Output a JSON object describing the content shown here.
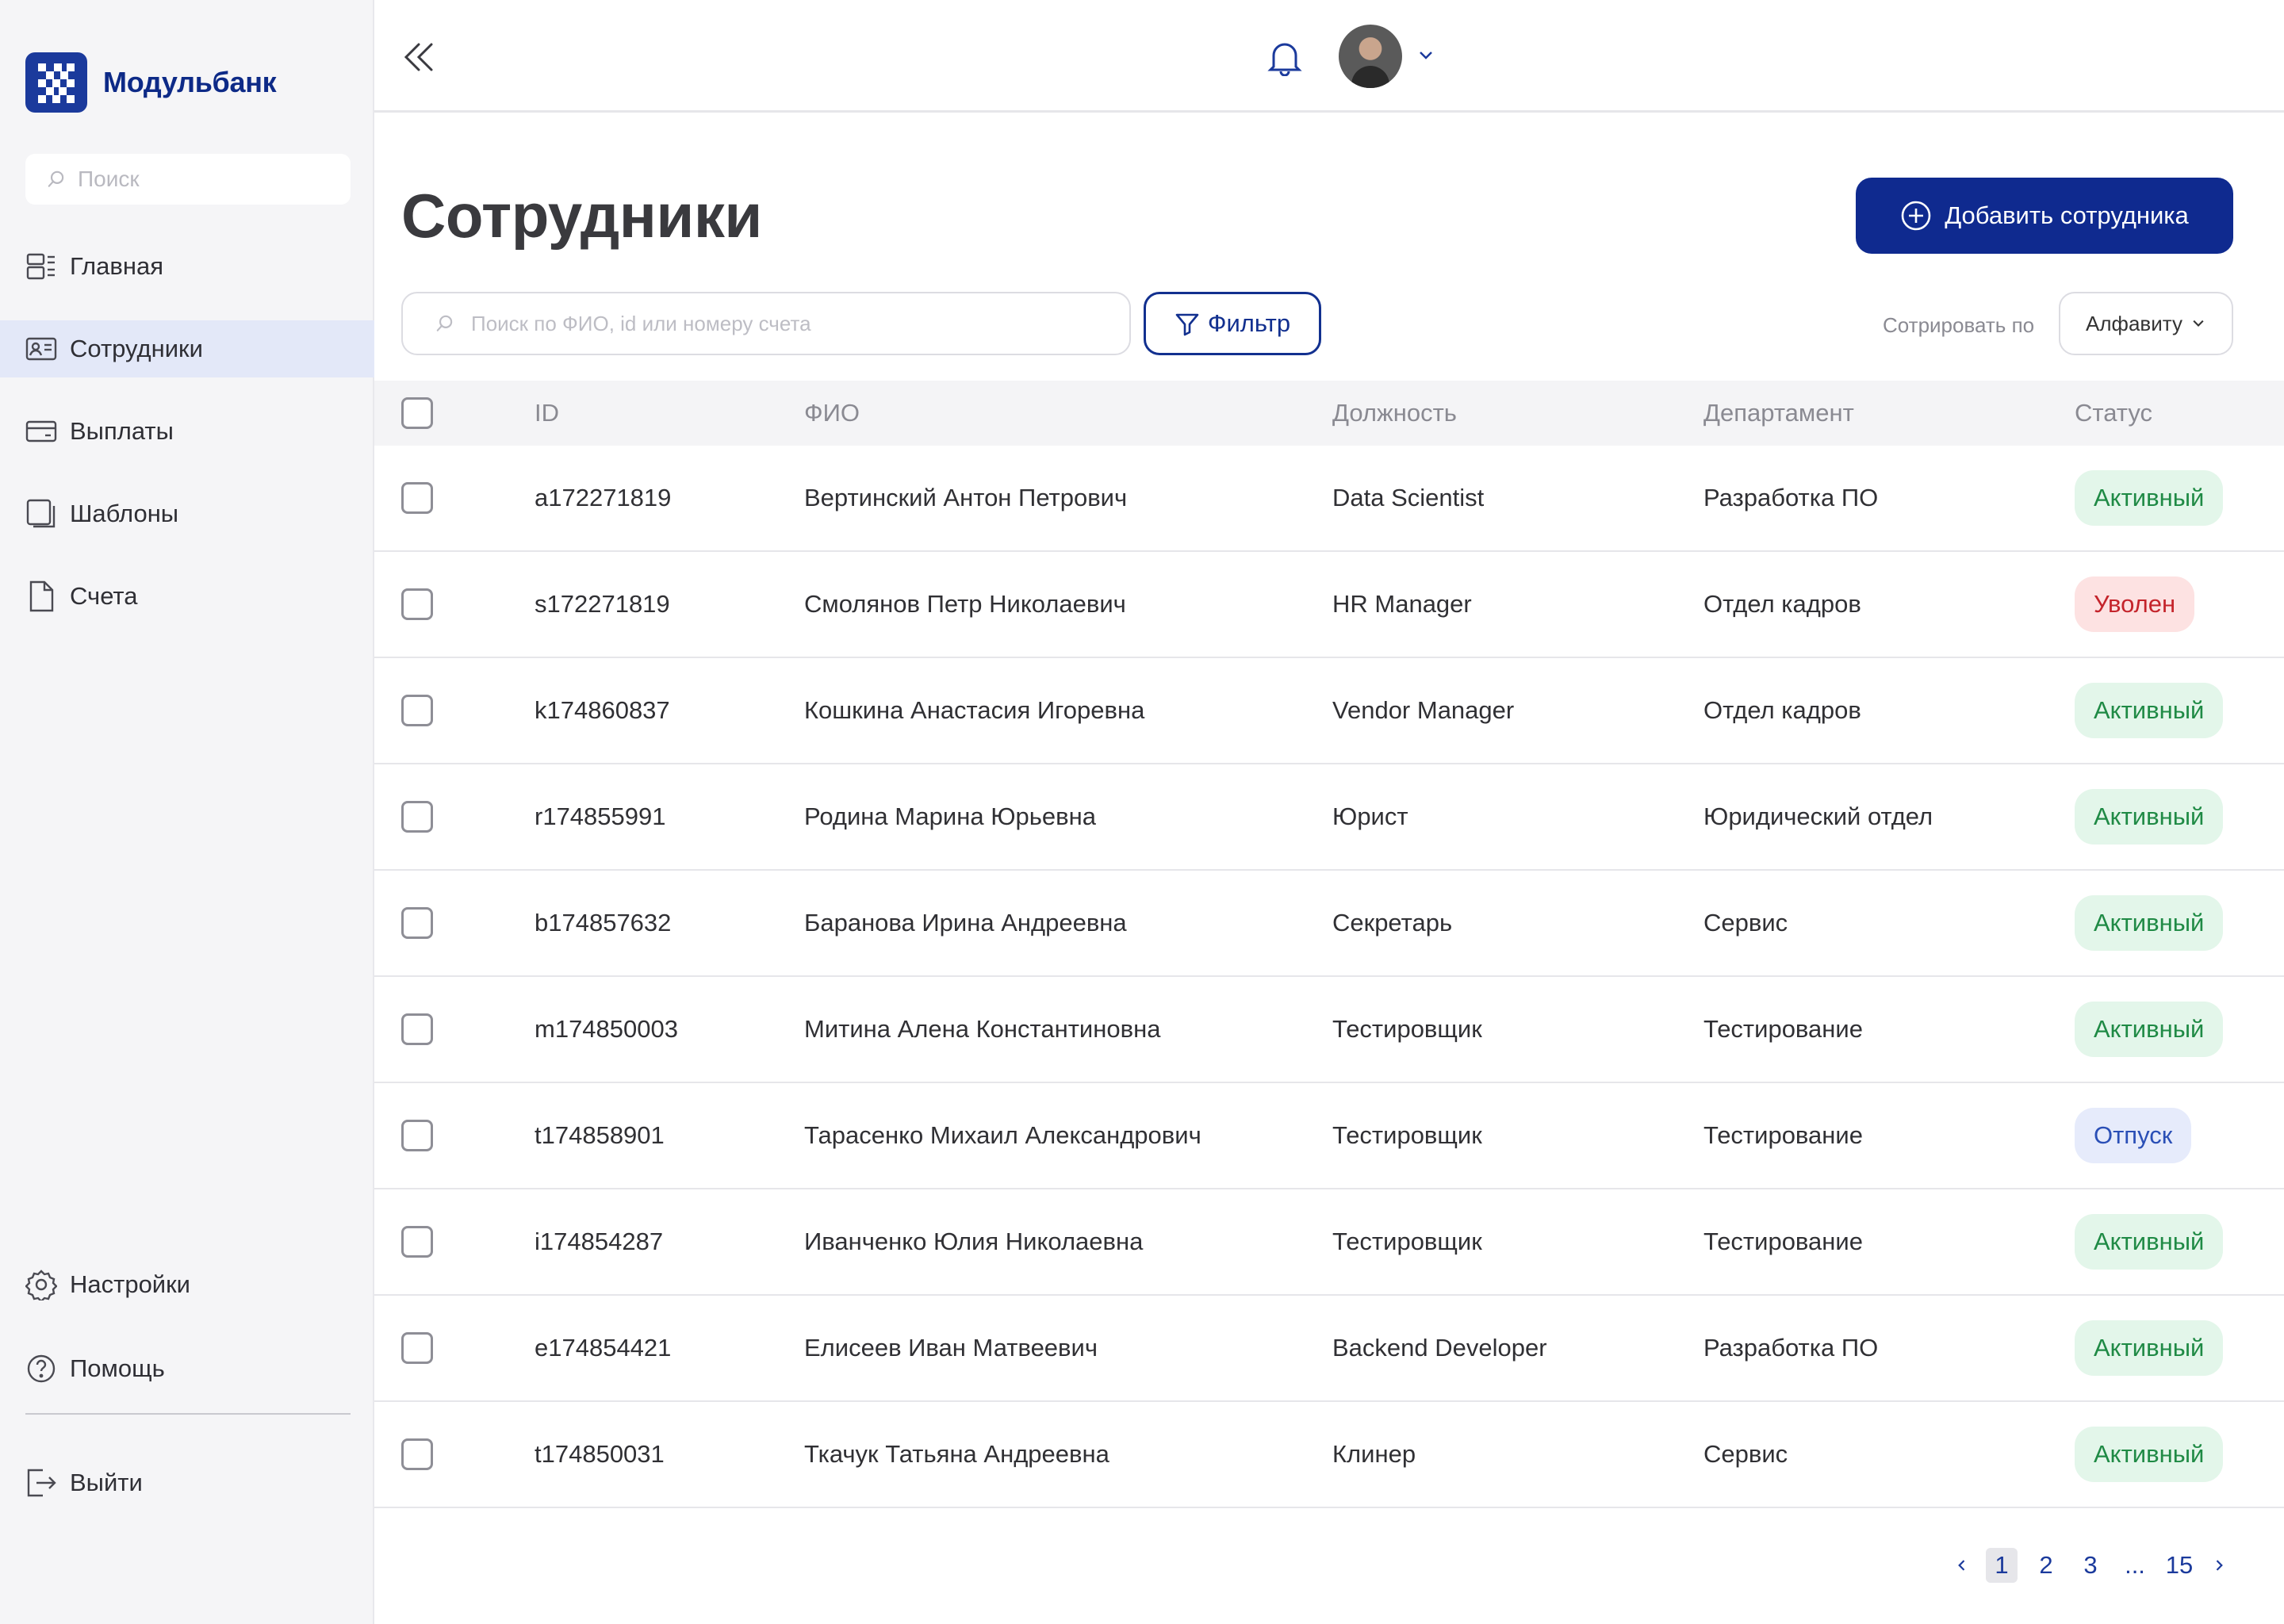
{
  "brand": {
    "name": "Модульбанк",
    "accent": "#0f2a8f"
  },
  "sidebar": {
    "search_placeholder": "Поиск",
    "items": [
      {
        "label": "Главная",
        "icon": "dashboard-icon"
      },
      {
        "label": "Сотрудники",
        "icon": "id-card-icon",
        "active": true
      },
      {
        "label": "Выплаты",
        "icon": "credit-card-icon"
      },
      {
        "label": "Шаблоны",
        "icon": "templates-icon"
      },
      {
        "label": "Счета",
        "icon": "document-icon"
      }
    ],
    "bottom_items": [
      {
        "label": "Настройки",
        "icon": "gear-icon"
      },
      {
        "label": "Помощь",
        "icon": "help-icon"
      }
    ],
    "logout_label": "Выйти"
  },
  "topbar": {
    "collapse_icon": "double-chevron-left-icon",
    "notifications_icon": "bell-icon",
    "avatar": "user-avatar"
  },
  "page": {
    "title": "Сотрудники",
    "add_button_label": "Добавить сотрудника",
    "search_placeholder": "Поиск по ФИО, id или номеру счета",
    "filter_label": "Фильтр",
    "sort_label": "Сотрировать по",
    "sort_value": "Алфавиту"
  },
  "table": {
    "headers": {
      "id": "ID",
      "fio": "ФИО",
      "position": "Должность",
      "department": "Департамент",
      "status": "Статус"
    },
    "rows": [
      {
        "id": "a172271819",
        "fio": "Вертинский Антон Петрович",
        "position": "Data Scientist",
        "department": "Разработка ПО",
        "status": "Активный",
        "status_type": "active"
      },
      {
        "id": "s172271819",
        "fio": "Смолянов Петр Николаевич",
        "position": "HR Manager",
        "department": "Отдел кадров",
        "status": "Уволен",
        "status_type": "fired"
      },
      {
        "id": "k174860837",
        "fio": "Кошкина Анастасия Игоревна",
        "position": "Vendor Manager",
        "department": "Отдел кадров",
        "status": "Активный",
        "status_type": "active"
      },
      {
        "id": "r174855991",
        "fio": "Родина Марина Юрьевна",
        "position": "Юрист",
        "department": "Юридический отдел",
        "status": "Активный",
        "status_type": "active"
      },
      {
        "id": "b174857632",
        "fio": "Баранова Ирина Андреевна",
        "position": "Секретарь",
        "department": "Сервис",
        "status": "Активный",
        "status_type": "active"
      },
      {
        "id": "m174850003",
        "fio": "Митина Алена Константиновна",
        "position": "Тестировщик",
        "department": "Тестирование",
        "status": "Активный",
        "status_type": "active"
      },
      {
        "id": "t174858901",
        "fio": "Тарасенко Михаил Александрович",
        "position": "Тестировщик",
        "department": "Тестирование",
        "status": "Отпуск",
        "status_type": "vacation"
      },
      {
        "id": "i174854287",
        "fio": "Иванченко Юлия Николаевна",
        "position": "Тестировщик",
        "department": "Тестирование",
        "status": "Активный",
        "status_type": "active"
      },
      {
        "id": "e174854421",
        "fio": "Елисеев Иван Матвеевич",
        "position": "Backend Developer",
        "department": "Разработка ПО",
        "status": "Активный",
        "status_type": "active"
      },
      {
        "id": "t174850031",
        "fio": "Ткачук Татьяна Андреевна",
        "position": "Клинер",
        "department": "Сервис",
        "status": "Активный",
        "status_type": "active"
      }
    ]
  },
  "pagination": {
    "pages": [
      "1",
      "2",
      "3",
      "...",
      "15"
    ],
    "current": "1"
  }
}
